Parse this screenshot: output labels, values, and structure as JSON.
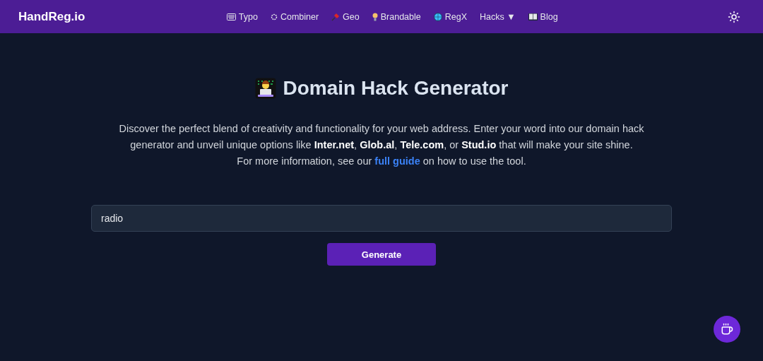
{
  "header": {
    "logo": "HandReg.io",
    "nav": [
      {
        "label": "Typo"
      },
      {
        "label": "Combiner"
      },
      {
        "label": "Geo"
      },
      {
        "label": "Brandable"
      },
      {
        "label": "RegX"
      },
      {
        "label": "Hacks ▼"
      },
      {
        "label": "Blog"
      }
    ]
  },
  "title": "Domain Hack Generator",
  "description": "Discover the perfect blend of creativity and functionality for your web address. Enter your word into our domain hack generator and unveil unique options like **Inter.net**, **Glob.al**, **Tele.com**, or **Stud.io** that will make your site shine.",
  "more_info": {
    "before": "For more information, see our",
    "link": "full guide",
    "after": "on how to use the tool."
  },
  "search": {
    "value": "radio"
  },
  "generate_button": "Generate"
}
